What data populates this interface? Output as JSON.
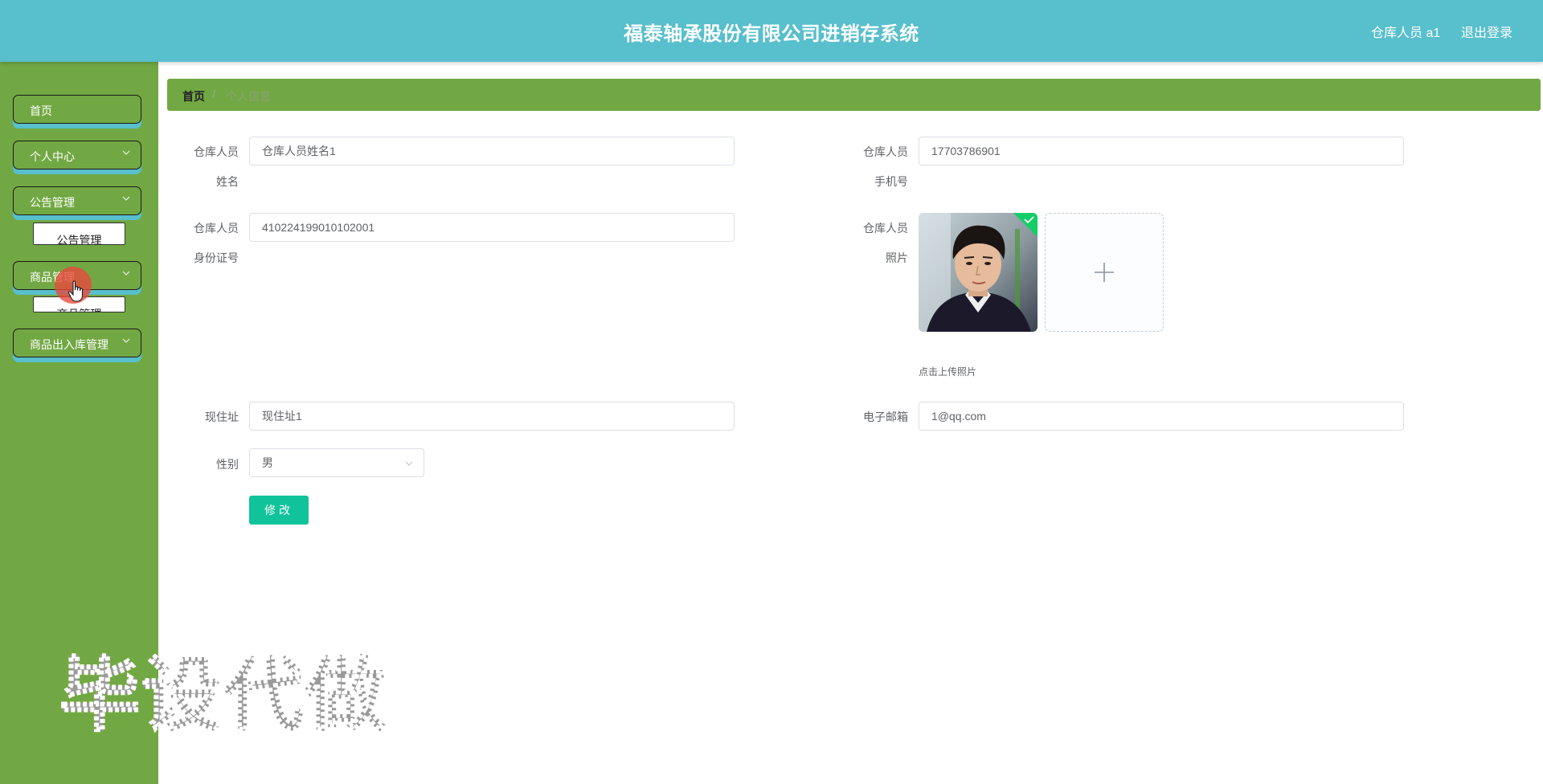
{
  "header": {
    "title": "福泰轴承股份有限公司进销存系统",
    "user_label": "仓库人员 a1",
    "logout_label": "退出登录"
  },
  "sidebar": {
    "items": [
      {
        "label": "首页"
      },
      {
        "label": "个人中心"
      },
      {
        "label": "公告管理",
        "submenu": "公告管理"
      },
      {
        "label": "商品管理",
        "submenu": "商品管理"
      },
      {
        "label": "商品出入库管理"
      }
    ]
  },
  "breadcrumb": {
    "home": "首页",
    "separator": "/",
    "current": "个人信息"
  },
  "form": {
    "name": {
      "label_line1": "仓库人员",
      "label_line2": "姓名",
      "value": "仓库人员姓名1"
    },
    "phone": {
      "label_line1": "仓库人员",
      "label_line2": "手机号",
      "value": "17703786901"
    },
    "idcard": {
      "label_line1": "仓库人员",
      "label_line2": "身份证号",
      "value": "410224199010102001"
    },
    "photo": {
      "label_line1": "仓库人员",
      "label_line2": "照片",
      "upload_tip": "点击上传照片"
    },
    "address": {
      "label": "现住址",
      "value": "现住址1"
    },
    "email": {
      "label": "电子邮箱",
      "value": "1@qq.com"
    },
    "gender": {
      "label": "性别",
      "value": "男"
    },
    "submit_label": "修改"
  },
  "watermark": {
    "text": "毕设代做"
  },
  "colors": {
    "header": "#58bfcc",
    "sidebar": "#72a843",
    "breadcrumb": "#72a843",
    "submit": "#11c39a"
  }
}
